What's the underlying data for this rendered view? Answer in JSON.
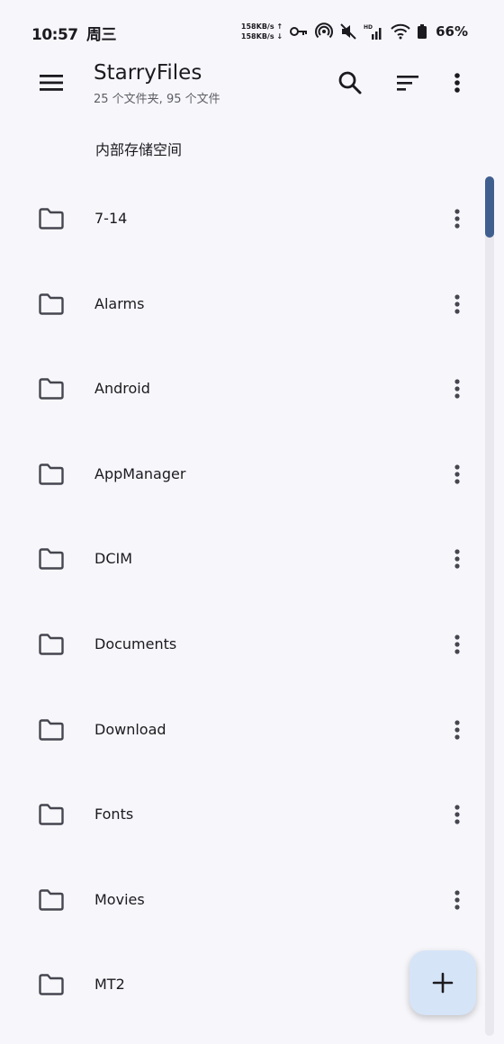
{
  "status_bar": {
    "time": "10:57",
    "weekday": "周三",
    "net_up": "158KB/s ↑",
    "net_down": "158KB/s ↓",
    "battery": "66%"
  },
  "app_bar": {
    "title": "StarryFiles",
    "subtitle": "25 个文件夹, 95 个文件"
  },
  "breadcrumb": "内部存储空间",
  "folders": [
    "7-14",
    "Alarms",
    "Android",
    "AppManager",
    "DCIM",
    "Documents",
    "Download",
    "Fonts",
    "Movies",
    "MT2"
  ],
  "scroll_position": 0.0,
  "fab_icon": "plus-icon",
  "colors": {
    "background": "#f7f7fb",
    "fab": "#d6e4f8",
    "scrollbar_thumb": "#3f5f8f"
  }
}
